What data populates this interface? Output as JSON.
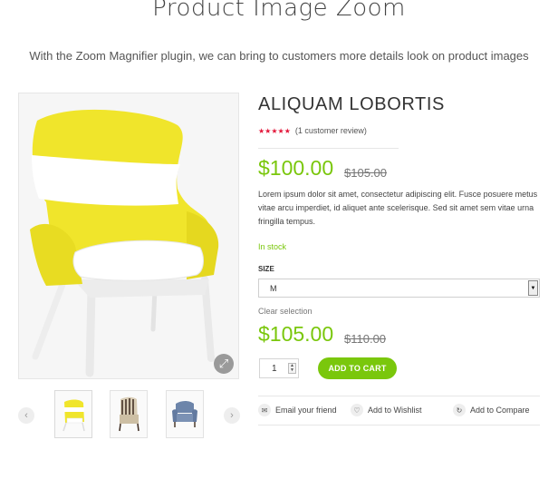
{
  "page": {
    "heading": "Product Image Zoom",
    "subheading": "With the Zoom Magnifier plugin, we can bring to customers more details look on product images"
  },
  "gallery": {
    "zoom_icon": "expand-icon",
    "prev_icon": "chevron-left-icon",
    "next_icon": "chevron-right-icon",
    "thumbnails": [
      "yellow-chair",
      "striped-chair",
      "blue-armchair"
    ]
  },
  "product": {
    "title": "ALIQUAM LOBORTIS",
    "stars": "★★★★★",
    "review_text": "(1 customer review)",
    "price_current": "$100.00",
    "price_old": "$105.00",
    "description": "Lorem ipsum dolor sit amet, consectetur adipiscing elit. Fusce posuere metus vitae arcu imperdiet, id aliquet ante scelerisque. Sed sit amet sem vitae urna fringilla tempus.",
    "stock": "In stock",
    "size_label": "SIZE",
    "size_value": "M",
    "clear_selection": "Clear selection",
    "variation_price_current": "$105.00",
    "variation_price_old": "$110.00",
    "quantity": "1",
    "add_to_cart": "ADD TO CART"
  },
  "actions": [
    {
      "label": "Email your friend",
      "icon": "envelope-icon"
    },
    {
      "label": "Add to Wishlist",
      "icon": "heart-icon"
    },
    {
      "label": "Add to Compare",
      "icon": "refresh-icon"
    }
  ],
  "colors": {
    "accent_green": "#7ac70c",
    "star_red": "#e3173a",
    "chair_yellow": "#f0e52b"
  }
}
